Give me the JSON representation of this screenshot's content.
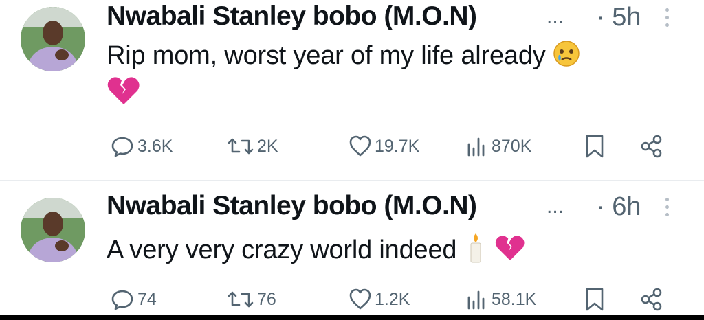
{
  "posts": [
    {
      "author": "Nwabali Stanley bobo (M.O.N)",
      "truncation": "...",
      "time": "· 5h",
      "text": "Rip mom, worst year of my life already",
      "emojis": [
        "crying-face",
        "broken-heart"
      ],
      "stats": {
        "replies": "3.6K",
        "reposts": "2K",
        "likes": "19.7K",
        "views": "870K"
      }
    },
    {
      "author": "Nwabali Stanley bobo (M.O.N)",
      "truncation": "...",
      "time": "· 6h",
      "text": "A very very crazy world indeed",
      "emojis": [
        "candle",
        "broken-heart"
      ],
      "stats": {
        "replies": "74",
        "reposts": "76",
        "likes": "1.2K",
        "views": "58.1K"
      }
    }
  ],
  "colors": {
    "text": "#0f1419",
    "muted": "#536471",
    "broken_heart": "#e0318f"
  }
}
